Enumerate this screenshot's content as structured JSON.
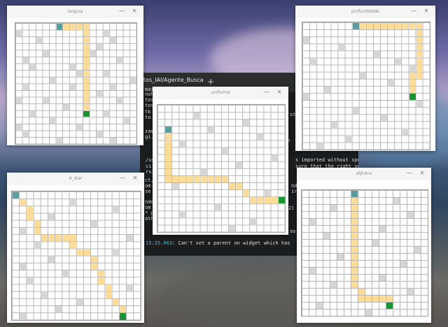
{
  "colors": {
    "obstacle": "#d6d6d6",
    "path": "#fbdc98",
    "start": "#5c9ea0",
    "goal": "#199433"
  },
  "terminal": {
    "tab_title": "etos_IAI/Agente_Busca",
    "new_tab_icon": "plus-icon",
    "lines": [
      {
        "ts": "",
        "text": "mai"
      },
      {
        "ts": "",
        "text": "noh"
      },
      {
        "ts": "",
        "text": "tos_"
      },
      {
        "ts": "",
        "text": "tos_"
      },
      {
        "ts": "",
        "text": "tk"
      },
      {
        "ts": "",
        "text": "to"
      },
      {
        "ts": "",
        "text": "zam"
      },
      {
        "ts": "",
        "text": "gi."
      },
      {
        "ts": "",
        "text": "/usr/lib/python3/dist-packages/kazam"
      },
      {
        "ts": "",
        "text": "cifying a version first. Use gi.requ"
      },
      {
        "ts": "",
        "text": "rsion gets loaded."
      },
      {
        "ts": "",
        "text": "ct,"
      },
      {
        "ts": "",
        "text": "om"
      },
      {
        "ts": "",
        "text": "se"
      },
      {
        "ts": "",
        "text": "nde"
      },
      {
        "ts": "",
        "text": "om"
      },
      {
        "ts": "",
        "text": "* p"
      },
      {
        "ts": "",
        "text": "ath"
      },
      {
        "ts": "15:35.063",
        "text": "Can't set a parent on widget which has"
      }
    ],
    "right_fragments": [
      "st",
      "k",
      "to",
      "s imported without spe",
      "sure that the right ve",
      "nde",
      "ir",
      "2)",
      "as"
    ]
  },
  "windows": [
    {
      "id": "largura",
      "title": "largura",
      "grid": {
        "rows": 18,
        "cols": 18
      },
      "start": [
        0,
        6
      ],
      "goal": [
        13,
        10
      ],
      "path": [
        [
          0,
          7
        ],
        [
          0,
          8
        ],
        [
          0,
          9
        ],
        [
          0,
          10
        ],
        [
          1,
          10
        ],
        [
          2,
          10
        ],
        [
          3,
          10
        ],
        [
          4,
          10
        ],
        [
          5,
          10
        ],
        [
          6,
          10
        ],
        [
          7,
          10
        ],
        [
          8,
          10
        ],
        [
          9,
          10
        ],
        [
          10,
          10
        ],
        [
          11,
          10
        ],
        [
          12,
          10
        ]
      ],
      "obstacles": [
        [
          1,
          0
        ],
        [
          1,
          13
        ],
        [
          2,
          3
        ],
        [
          2,
          14
        ],
        [
          3,
          12
        ],
        [
          4,
          4
        ],
        [
          4,
          11
        ],
        [
          5,
          1
        ],
        [
          5,
          15
        ],
        [
          6,
          2
        ],
        [
          6,
          8
        ],
        [
          7,
          9
        ],
        [
          7,
          13
        ],
        [
          8,
          5
        ],
        [
          8,
          17
        ],
        [
          9,
          1
        ],
        [
          9,
          8
        ],
        [
          9,
          14
        ],
        [
          10,
          12
        ],
        [
          11,
          0
        ],
        [
          11,
          4
        ],
        [
          11,
          15
        ],
        [
          12,
          7
        ],
        [
          13,
          2
        ],
        [
          13,
          13
        ],
        [
          14,
          5
        ],
        [
          14,
          16
        ],
        [
          15,
          0
        ],
        [
          15,
          9
        ],
        [
          16,
          1
        ],
        [
          16,
          12
        ],
        [
          17,
          6
        ],
        [
          17,
          14
        ]
      ]
    },
    {
      "id": "profundidade",
      "title": "profundidade",
      "grid": {
        "rows": 18,
        "cols": 18
      },
      "start": [
        0,
        7
      ],
      "goal": [
        10,
        15
      ],
      "path": [
        [
          0,
          8
        ],
        [
          0,
          9
        ],
        [
          0,
          10
        ],
        [
          0,
          11
        ],
        [
          0,
          12
        ],
        [
          0,
          13
        ],
        [
          0,
          14
        ],
        [
          0,
          15
        ],
        [
          0,
          16
        ],
        [
          1,
          16
        ],
        [
          2,
          16
        ],
        [
          3,
          16
        ],
        [
          4,
          16
        ],
        [
          5,
          16
        ],
        [
          6,
          16
        ],
        [
          7,
          16
        ],
        [
          7,
          15
        ],
        [
          8,
          15
        ],
        [
          9,
          15
        ]
      ],
      "obstacles": [
        [
          2,
          0
        ],
        [
          3,
          5
        ],
        [
          4,
          10
        ],
        [
          5,
          13
        ],
        [
          5,
          1
        ],
        [
          6,
          15
        ],
        [
          7,
          8
        ],
        [
          8,
          12
        ],
        [
          9,
          3
        ],
        [
          10,
          0
        ],
        [
          11,
          16
        ],
        [
          12,
          7
        ],
        [
          13,
          11
        ],
        [
          14,
          4
        ],
        [
          15,
          14
        ],
        [
          16,
          6
        ],
        [
          17,
          2
        ]
      ]
    },
    {
      "id": "uniforme",
      "title": "uniforme",
      "grid": {
        "rows": 18,
        "cols": 18
      },
      "start": [
        3,
        1
      ],
      "goal": [
        13,
        17
      ],
      "path": [
        [
          4,
          1
        ],
        [
          5,
          1
        ],
        [
          6,
          1
        ],
        [
          7,
          1
        ],
        [
          8,
          1
        ],
        [
          9,
          1
        ],
        [
          10,
          1
        ],
        [
          10,
          2
        ],
        [
          10,
          3
        ],
        [
          10,
          4
        ],
        [
          10,
          5
        ],
        [
          10,
          6
        ],
        [
          10,
          7
        ],
        [
          10,
          8
        ],
        [
          10,
          9
        ],
        [
          11,
          10
        ],
        [
          11,
          11
        ],
        [
          12,
          12
        ],
        [
          13,
          13
        ],
        [
          13,
          14
        ],
        [
          13,
          15
        ],
        [
          13,
          16
        ]
      ],
      "obstacles": [
        [
          1,
          5
        ],
        [
          2,
          12
        ],
        [
          3,
          7
        ],
        [
          4,
          14
        ],
        [
          5,
          3
        ],
        [
          6,
          9
        ],
        [
          7,
          16
        ],
        [
          8,
          11
        ],
        [
          9,
          6
        ],
        [
          11,
          2
        ],
        [
          12,
          15
        ],
        [
          14,
          8
        ],
        [
          15,
          3
        ],
        [
          16,
          13
        ],
        [
          17,
          10
        ]
      ]
    },
    {
      "id": "a_star",
      "title": "A_star",
      "grid": {
        "rows": 18,
        "cols": 18
      },
      "start": [
        0,
        0
      ],
      "goal": [
        17,
        15
      ],
      "path": [
        [
          1,
          1
        ],
        [
          2,
          2
        ],
        [
          3,
          2
        ],
        [
          4,
          3
        ],
        [
          5,
          3
        ],
        [
          6,
          4
        ],
        [
          6,
          5
        ],
        [
          6,
          6
        ],
        [
          6,
          7
        ],
        [
          6,
          8
        ],
        [
          7,
          8
        ],
        [
          8,
          9
        ],
        [
          8,
          10
        ],
        [
          9,
          11
        ],
        [
          10,
          11
        ],
        [
          11,
          12
        ],
        [
          12,
          12
        ],
        [
          13,
          13
        ],
        [
          14,
          13
        ],
        [
          15,
          14
        ],
        [
          16,
          15
        ]
      ],
      "obstacles": [
        [
          1,
          8
        ],
        [
          2,
          14
        ],
        [
          3,
          5
        ],
        [
          4,
          11
        ],
        [
          5,
          1
        ],
        [
          6,
          16
        ],
        [
          7,
          3
        ],
        [
          8,
          14
        ],
        [
          9,
          5
        ],
        [
          10,
          1
        ],
        [
          11,
          7
        ],
        [
          12,
          2
        ],
        [
          13,
          16
        ],
        [
          14,
          4
        ],
        [
          15,
          9
        ],
        [
          16,
          6
        ],
        [
          17,
          1
        ]
      ]
    },
    {
      "id": "dijkstra",
      "title": "dijkstra",
      "grid": {
        "rows": 18,
        "cols": 18
      },
      "start": [
        0,
        7
      ],
      "goal": [
        16,
        12
      ],
      "path": [
        [
          1,
          7
        ],
        [
          2,
          7
        ],
        [
          3,
          7
        ],
        [
          4,
          7
        ],
        [
          5,
          7
        ],
        [
          6,
          7
        ],
        [
          7,
          7
        ],
        [
          8,
          7
        ],
        [
          9,
          7
        ],
        [
          10,
          7
        ],
        [
          11,
          7
        ],
        [
          12,
          7
        ],
        [
          13,
          7
        ],
        [
          14,
          8
        ],
        [
          15,
          8
        ],
        [
          15,
          9
        ],
        [
          15,
          10
        ],
        [
          15,
          11
        ],
        [
          15,
          12
        ]
      ],
      "obstacles": [
        [
          1,
          13
        ],
        [
          2,
          4
        ],
        [
          3,
          15
        ],
        [
          4,
          1
        ],
        [
          5,
          11
        ],
        [
          6,
          3
        ],
        [
          7,
          10
        ],
        [
          8,
          16
        ],
        [
          9,
          5
        ],
        [
          10,
          14
        ],
        [
          11,
          1
        ],
        [
          12,
          11
        ],
        [
          13,
          4
        ],
        [
          14,
          15
        ],
        [
          16,
          2
        ],
        [
          17,
          9
        ]
      ]
    }
  ],
  "close_glyph": "×",
  "minimize_glyph": "—"
}
